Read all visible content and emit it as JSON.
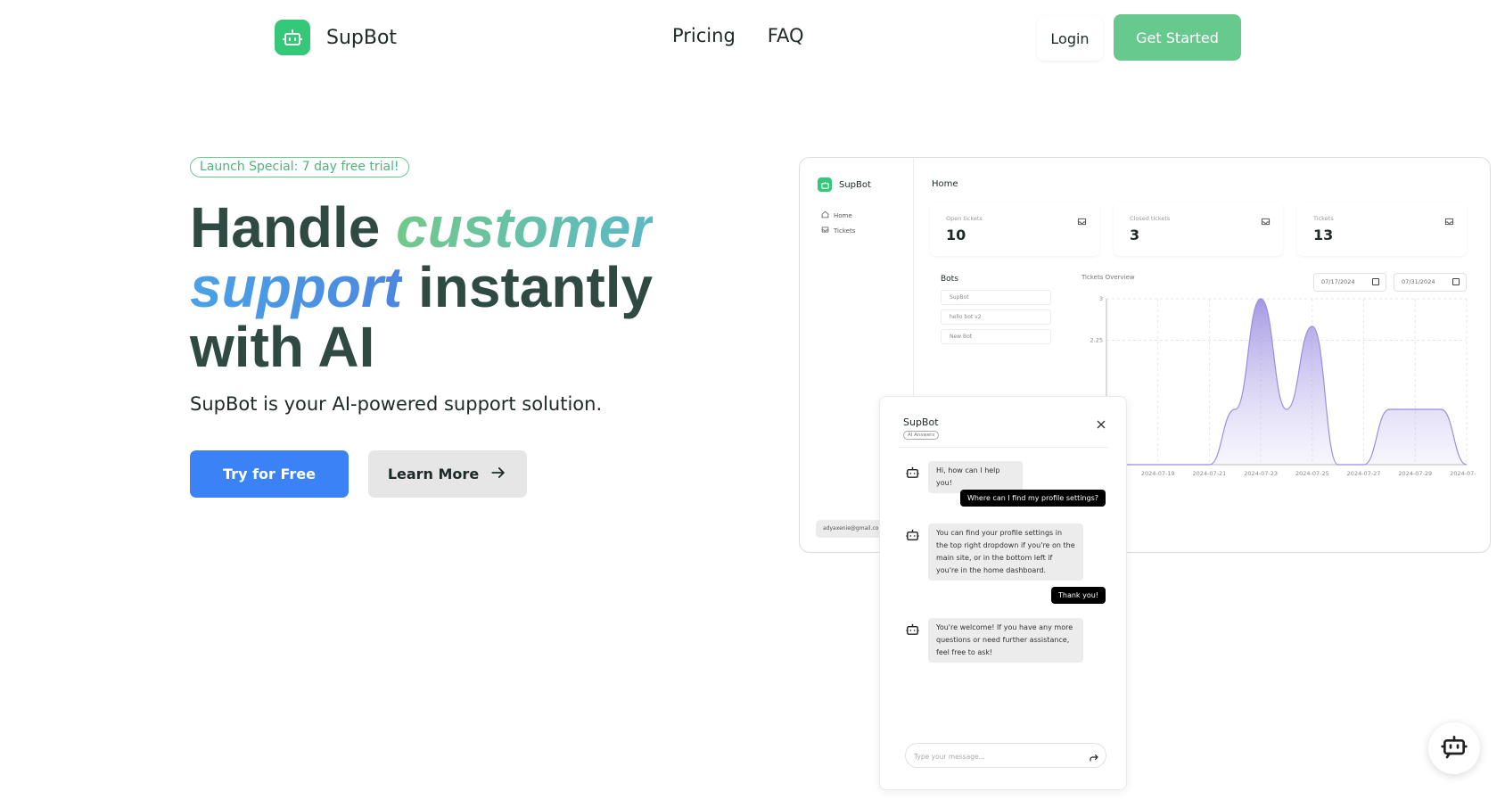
{
  "brand": {
    "name": "SupBot"
  },
  "nav": {
    "pricing": "Pricing",
    "faq": "FAQ"
  },
  "header": {
    "login": "Login",
    "get_started": "Get Started"
  },
  "hero": {
    "badge": "Launch Special: 7 day free trial!",
    "title_handle": "Handle",
    "title_customer": "customer",
    "title_support": "support",
    "title_instantly": "instantly",
    "title_with_ai": "with AI",
    "subtitle": "SupBot is your AI-powered support solution.",
    "try_button": "Try for Free",
    "learn_button": "Learn More"
  },
  "dashboard": {
    "brand": "SupBot",
    "nav": [
      "Home",
      "Tickets"
    ],
    "user_email": "adyaxenie@gmail.com",
    "page_title": "Home",
    "stats": [
      {
        "label": "Open tickets",
        "value": "10"
      },
      {
        "label": "Closed tickets",
        "value": "3"
      },
      {
        "label": "Tickets",
        "value": "13"
      }
    ],
    "bots_title": "Bots",
    "bots": [
      "SupBot",
      "hello bot v2",
      "New Bot"
    ],
    "chart_title": "Tickets Overview",
    "date_from": "07/17/2024",
    "date_to": "07/31/2024"
  },
  "chart_data": {
    "type": "area",
    "title": "Tickets Overview",
    "x": [
      "2024-07-17",
      "2024-07-18",
      "2024-07-19",
      "2024-07-20",
      "2024-07-21",
      "2024-07-22",
      "2024-07-23",
      "2024-07-24",
      "2024-07-25",
      "2024-07-26",
      "2024-07-27",
      "2024-07-28",
      "2024-07-29",
      "2024-07-30",
      "2024-07-31"
    ],
    "values": [
      0,
      0,
      0,
      0,
      0,
      1,
      3,
      1,
      2.5,
      0,
      0,
      1,
      1,
      1,
      0
    ],
    "x_ticks": [
      "2024-07-19",
      "2024-07-21",
      "2024-07-23",
      "2024-07-25",
      "2024-07-27",
      "2024-07-29",
      "2024-07-31"
    ],
    "y_ticks": [
      "3",
      "2.25"
    ],
    "ylim": [
      0,
      3
    ],
    "grid": true,
    "color": "#9b8ee0"
  },
  "chat": {
    "title": "SupBot",
    "tag": "AI Answers",
    "messages": [
      {
        "from": "bot",
        "text": "Hi, how can I help you!"
      },
      {
        "from": "user",
        "text": "Where can I find my profile settings?"
      },
      {
        "from": "bot",
        "text": "You can find your profile settings in the top right dropdown if you're on the main site, or in the bottom left if you're in the home dashboard."
      },
      {
        "from": "user",
        "text": "Thank you!"
      },
      {
        "from": "bot",
        "text": "You're welcome! If you have any more questions or need further assistance, feel free to ask!"
      }
    ],
    "input_placeholder": "Type your message..."
  },
  "colors": {
    "brand_green": "#34c878",
    "cta_green": "#68c98f",
    "primary_blue": "#3b82f6",
    "chart_purple": "#9b8ee0",
    "heading": "#2f4a42"
  },
  "icons": {
    "logo": "robot-icon",
    "learn_more": "arrow-right-icon",
    "stats": "inbox-icon",
    "close": "close-icon",
    "send": "send-icon",
    "fab": "robot-chat-icon"
  }
}
